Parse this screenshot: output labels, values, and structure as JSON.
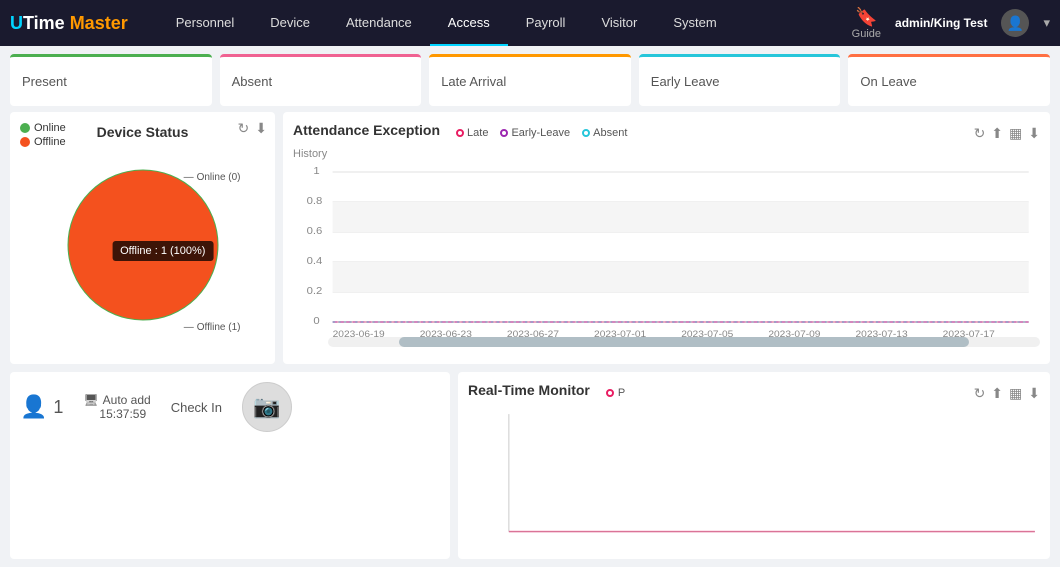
{
  "app": {
    "logo_u": "U",
    "logo_time": "Time ",
    "logo_master": "Master"
  },
  "nav": {
    "items": [
      {
        "label": "Personnel",
        "active": false
      },
      {
        "label": "Device",
        "active": false
      },
      {
        "label": "Attendance",
        "active": false
      },
      {
        "label": "Access",
        "active": true
      },
      {
        "label": "Payroll",
        "active": false
      },
      {
        "label": "Visitor",
        "active": false
      },
      {
        "label": "System",
        "active": false
      }
    ],
    "guide_label": "Guide",
    "user_path": "admin/King Test"
  },
  "stats": [
    {
      "label": "Present",
      "type": "present"
    },
    {
      "label": "Absent",
      "type": "absent"
    },
    {
      "label": "Late Arrival",
      "type": "late"
    },
    {
      "label": "Early Leave",
      "type": "early-leave"
    },
    {
      "label": "On Leave",
      "type": "on-leave"
    }
  ],
  "device_status": {
    "title": "Device Status",
    "legend_online": "Online",
    "legend_offline": "Offline",
    "tooltip": "Offline : 1 (100%)",
    "label_online": "Online (0)",
    "label_offline": "Offline (1)"
  },
  "attendance_exception": {
    "title": "Attendance Exception",
    "history_label": "History",
    "legend": [
      {
        "label": "Late",
        "type": "late"
      },
      {
        "label": "Early-Leave",
        "type": "early-leave"
      },
      {
        "label": "Absent",
        "type": "absent"
      }
    ],
    "y_labels": [
      "1",
      "0.8",
      "0.6",
      "0.4",
      "0.2",
      "0"
    ],
    "x_labels": [
      "2023-06-19",
      "2023-06-23",
      "2023-06-27",
      "2023-07-01",
      "2023-07-05",
      "2023-07-09",
      "2023-07-13",
      "2023-07-17"
    ]
  },
  "checkin": {
    "count": "1",
    "auto_add_label": "Auto add",
    "auto_add_time": "15:37:59",
    "check_in_label": "Check In"
  },
  "realtime_monitor": {
    "title": "Real-Time Monitor",
    "legend_p": "P"
  },
  "icons": {
    "refresh": "↻",
    "upload": "↑",
    "bar_chart": "▦",
    "download": "↓",
    "chevron_down": "▾",
    "camera": "📷"
  }
}
